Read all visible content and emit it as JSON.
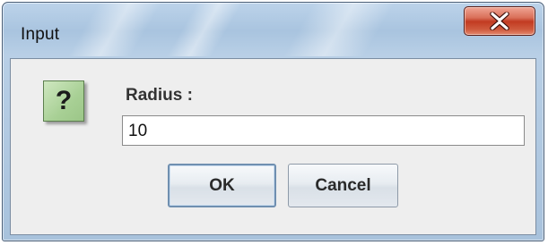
{
  "window": {
    "title": "Input"
  },
  "titlebar": {
    "close_icon": "close-icon"
  },
  "dialog": {
    "icon": "question-icon",
    "icon_glyph": "?",
    "label": "Radius :",
    "input_value": "10"
  },
  "buttons": {
    "ok_label": "OK",
    "cancel_label": "Cancel"
  },
  "colors": {
    "titlebar": "#b8cfe6",
    "client_bg": "#eeeeee",
    "close_button": "#c23b22",
    "question_icon_bg": "#a8d095",
    "default_button_border": "#6f8fb0"
  }
}
